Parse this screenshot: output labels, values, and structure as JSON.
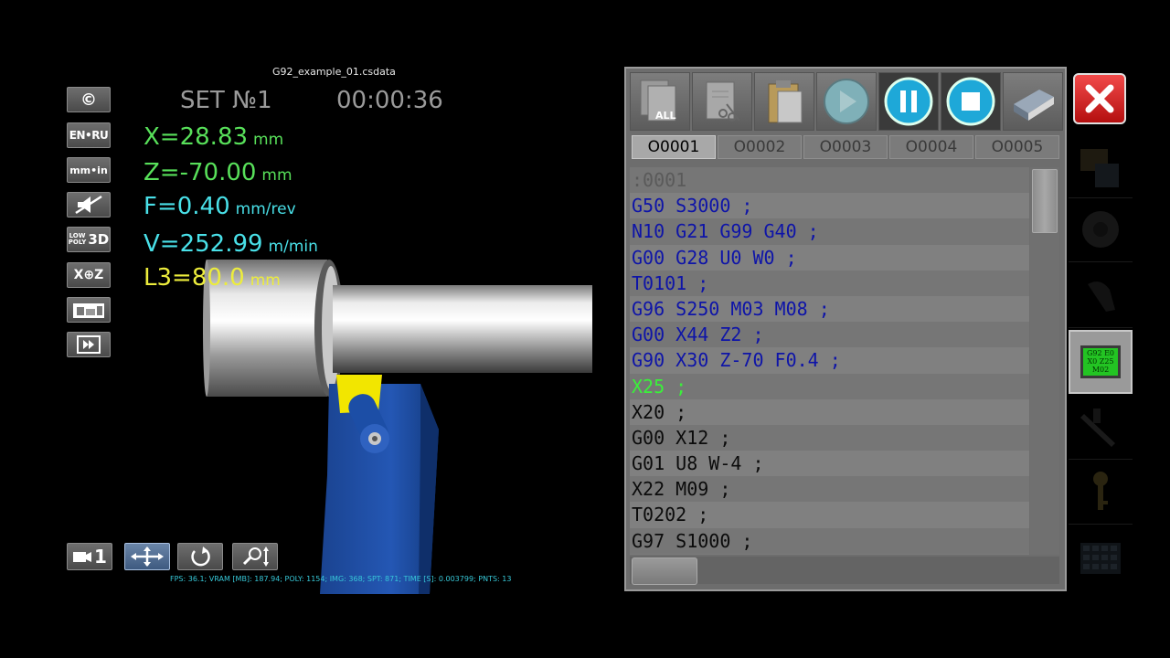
{
  "header": {
    "filename": "G92_example_01.csdata",
    "set_label": "SET №1",
    "timer": "00:00:36"
  },
  "readouts": {
    "x": {
      "label": "X=28.83",
      "unit": "mm"
    },
    "z": {
      "label": "Z=-70.00",
      "unit": "mm"
    },
    "f": {
      "label": "F=0.40",
      "unit": "mm/rev"
    },
    "v": {
      "label": "V=252.99",
      "unit": "m/min"
    },
    "l3": {
      "label": "L3=80.0",
      "unit": "mm"
    }
  },
  "side_buttons": {
    "copyright": "©",
    "lang": "EN•RU",
    "units": "mm•in",
    "lowpoly": "LOW POLY 3D",
    "xz": "X⊕Z"
  },
  "bottom_buttons": {
    "camera": "1"
  },
  "stats": "FPS: 36.1; VRAM [MB]: 187.94; POLY: 1154; IMG: 368; SPT: 871; TIME [S]: 0.003799; PNTS: 13",
  "editor": {
    "tabs": [
      "O0001",
      "O0002",
      "O0003",
      "O0004",
      "O0005"
    ],
    "active_tab": 0,
    "tool_all_label": "ALL",
    "lines": [
      {
        "text": ":0001",
        "kind": "comment"
      },
      {
        "text": "G50 S3000 ;",
        "kind": "code"
      },
      {
        "text": "N10 G21 G99 G40 ;",
        "kind": "code"
      },
      {
        "text": "G00 G28 U0 W0 ;",
        "kind": "code"
      },
      {
        "text": "T0101 ;",
        "kind": "code"
      },
      {
        "text": "G96 S250 M03 M08 ;",
        "kind": "code"
      },
      {
        "text": "G00 X44 Z2 ;",
        "kind": "code"
      },
      {
        "text": "G90 X30 Z-70 F0.4 ;",
        "kind": "code"
      },
      {
        "text": "X25 ;",
        "kind": "current"
      },
      {
        "text": "X20 ;",
        "kind": "plain"
      },
      {
        "text": "G00 X12 ;",
        "kind": "plain"
      },
      {
        "text": "G01 U8 W-4 ;",
        "kind": "plain"
      },
      {
        "text": "X22 M09 ;",
        "kind": "plain"
      },
      {
        "text": "T0202 ;",
        "kind": "plain"
      },
      {
        "text": "G97 S1000 ;",
        "kind": "plain"
      }
    ]
  },
  "gcode_icon_text": [
    "G92 E0",
    "X0 Z25",
    "M02"
  ],
  "colors": {
    "readout_green": "#58e05a",
    "readout_cyan": "#49e0e8",
    "readout_yellow": "#ecec3c",
    "code_blue": "#0e14a8",
    "current_line_green": "#3af03a",
    "close_red": "#d42020",
    "tool_insert_yellow": "#f2e600",
    "tool_holder_blue": "#1e4fa8"
  }
}
